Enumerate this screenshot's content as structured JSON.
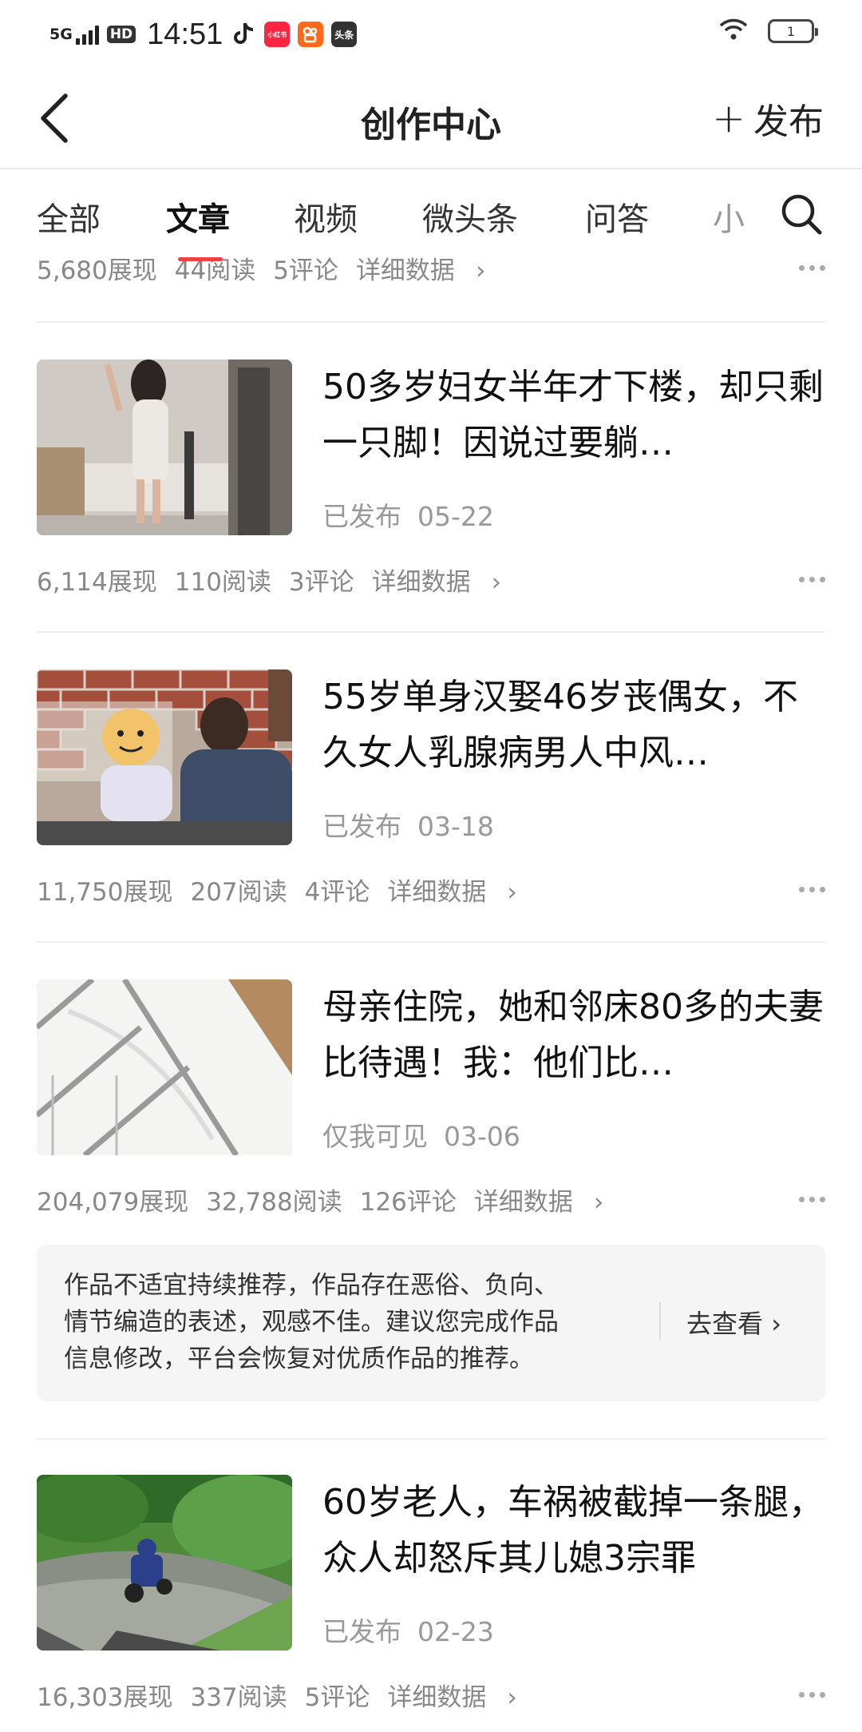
{
  "status_bar": {
    "network": "5G",
    "hd": "HD",
    "time": "14:51",
    "apps": [
      {
        "name": "douyin-icon",
        "label": ""
      },
      {
        "name": "xiaohongshu-icon",
        "label": "小红书"
      },
      {
        "name": "kuaishou-icon",
        "label": ""
      },
      {
        "name": "toutiao-icon",
        "label": "头条"
      }
    ],
    "battery_level": "1"
  },
  "header": {
    "title": "创作中心",
    "publish_label": "发布"
  },
  "tabs": [
    {
      "label": "全部",
      "active": false
    },
    {
      "label": "文章",
      "active": true
    },
    {
      "label": "视频",
      "active": false
    },
    {
      "label": "微头条",
      "active": false
    },
    {
      "label": "问答",
      "active": false
    },
    {
      "label": "小",
      "active": false
    }
  ],
  "top_partial_stats": {
    "views": "5,680展现",
    "reads": "44阅读",
    "comments": "5评论",
    "detail": "详细数据"
  },
  "articles": [
    {
      "title": "50多岁妇女半年才下楼，却只剩一只脚！因说过要躺…",
      "status": "已发布",
      "date": "05-22",
      "views": "6,114展现",
      "reads": "110阅读",
      "comments": "3评论",
      "detail": "详细数据"
    },
    {
      "title": "55岁单身汉娶46岁丧偶女，不久女人乳腺病男人中风…",
      "status": "已发布",
      "date": "03-18",
      "views": "11,750展现",
      "reads": "207阅读",
      "comments": "4评论",
      "detail": "详细数据"
    },
    {
      "title": "母亲住院，她和邻床80多的夫妻比待遇！我：他们比…",
      "status": "仅我可见",
      "date": "03-06",
      "views": "204,079展现",
      "reads": "32,788阅读",
      "comments": "126评论",
      "detail": "详细数据"
    },
    {
      "title": "60岁老人，车祸被截掉一条腿，众人却怒斥其儿媳3宗罪",
      "status": "已发布",
      "date": "02-23",
      "views": "16,303展现",
      "reads": "337阅读",
      "comments": "5评论",
      "detail": "详细数据"
    }
  ],
  "notice": {
    "line1": "作品不适宜持续推荐，作品存在恶俗、负向、",
    "line2": "情节编造的表述，观感不佳。建议您完成作品",
    "line3": "信息修改，平台会恢复对优质作品的推荐。",
    "action": "去查看"
  },
  "colors": {
    "accent": "#f04142",
    "muted": "#888888",
    "notice_bg": "#f5f5f5"
  }
}
